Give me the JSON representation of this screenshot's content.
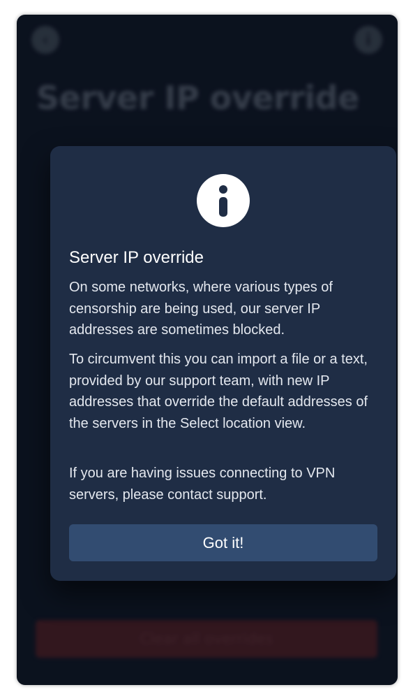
{
  "background": {
    "title": "Server IP override",
    "back_icon": "chevron-left-icon",
    "info_icon": "info-icon",
    "clear_button_label": "Clear all overrides"
  },
  "dialog": {
    "icon": "info-icon",
    "title": "Server IP override",
    "paragraphs": [
      "On some networks, where various types of censorship are being used, our server IP addresses are sometimes blocked.",
      "To circumvent this you can import a file or a text, provided by our support team, with new IP addresses that override the default addresses of the servers in the Select location view.",
      "If you are having issues connecting to VPN servers, please contact support."
    ],
    "confirm_label": "Got it!"
  },
  "colors": {
    "window_bg": "#0f1726",
    "dialog_bg": "#1f2d45",
    "button_bg": "#324c71",
    "danger_bg": "#4a1f26",
    "text": "#ffffff"
  }
}
